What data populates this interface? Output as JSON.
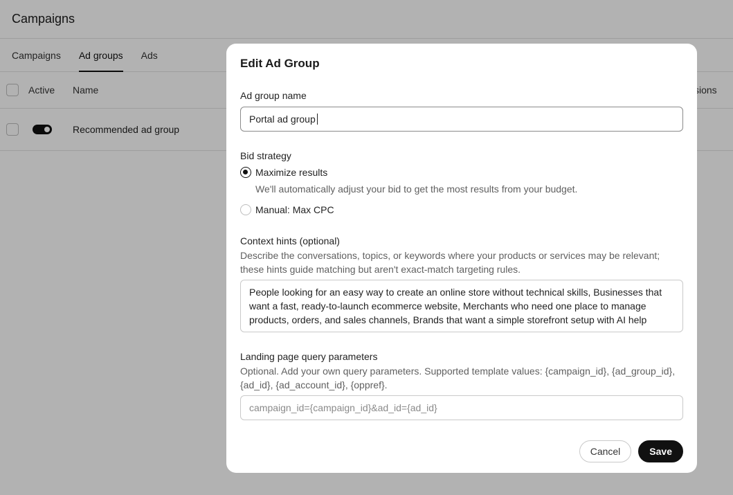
{
  "page": {
    "title": "Campaigns",
    "tabs": [
      {
        "label": "Campaigns"
      },
      {
        "label": "Ad groups"
      },
      {
        "label": "Ads"
      }
    ],
    "table": {
      "headers": {
        "active": "Active",
        "name": "Name",
        "impressions_partial": "ssions"
      },
      "rows": [
        {
          "active": true,
          "name": "Recommended ad group"
        }
      ]
    }
  },
  "modal": {
    "title": "Edit Ad Group",
    "ad_group_name": {
      "label": "Ad group name",
      "value": "Portal ad group"
    },
    "bid_strategy": {
      "label": "Bid strategy",
      "options": [
        {
          "label": "Maximize results",
          "selected": true,
          "description": "We'll automatically adjust your bid to get the most results from your budget."
        },
        {
          "label": "Manual: Max CPC",
          "selected": false
        }
      ]
    },
    "context_hints": {
      "label": "Context hints (optional)",
      "help": "Describe the conversations, topics, or keywords where your products or services may be relevant; these hints guide matching but aren't exact-match targeting rules.",
      "value": "People looking for an easy way to create an online store without technical skills, Businesses that want a fast, ready-to-launch ecommerce website, Merchants who need one place to manage products, orders, and sales channels, Brands that want a simple storefront setup with AI help"
    },
    "landing_params": {
      "label": "Landing page query parameters",
      "help": "Optional. Add your own query parameters. Supported template values: {campaign_id}, {ad_group_id}, {ad_id}, {ad_account_id}, {oppref}.",
      "placeholder": "campaign_id={campaign_id}&ad_id={ad_id}"
    },
    "buttons": {
      "cancel": "Cancel",
      "save": "Save"
    }
  },
  "colors": {
    "accent": "#111111",
    "overlay": "rgba(0,0,0,0.30)"
  }
}
